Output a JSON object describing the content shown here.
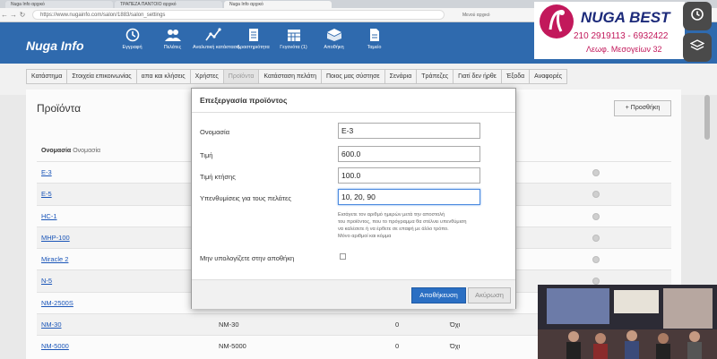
{
  "browser": {
    "tabs": [
      "Nuga Info αρχικό",
      "ΤΡΑΠΕΖΑ ΠΑΝΤΟΙΟ αρχικό",
      "Nuga Info αρχικό"
    ],
    "url": "https://www.nugainfo.com/salon/1883/salon_settings",
    "bookmark": "Μενού αρχικό"
  },
  "app": {
    "brand": "Nuga Info",
    "nav": [
      {
        "label": "Εγγραφή",
        "icon": "clock-icon"
      },
      {
        "label": "Πελάτες",
        "icon": "users-icon"
      },
      {
        "label": "Αναλυτική κατάσταση",
        "icon": "chart-icon"
      },
      {
        "label": "Δραστηριότητα",
        "icon": "document-icon"
      },
      {
        "label": "Γεγονότα (1)",
        "icon": "calendar-icon"
      },
      {
        "label": "Αποθήκη",
        "icon": "box-icon"
      },
      {
        "label": "Ταμείο",
        "icon": "file-icon"
      }
    ]
  },
  "logo": {
    "name": "NUGA BEST",
    "phone": "210 2919113 - 6932422",
    "address": "Λεωφ. Μεσογείων 32"
  },
  "menu": {
    "tabs": [
      "Κατάστημα",
      "Στοιχεία επικοινωνίας",
      "απα και κλήσεις",
      "Χρήστες",
      "Προϊόντα",
      "Κατάσταση πελάτη",
      "Ποιος μας σύστησε",
      "Σενάρια",
      "Τράπεζες",
      "Γιατί δεν ήρθε",
      "Έξοδα",
      "Αναφορές"
    ],
    "active_index": 4
  },
  "page": {
    "title": "Προϊόντα",
    "add_button": "+ Προσθήκη",
    "column_header": "Ονομασία",
    "column_header_sub": "Ονομασία",
    "rows": [
      {
        "name": "E-3",
        "code": "",
        "num": "",
        "yn": ""
      },
      {
        "name": "E-5",
        "code": "",
        "num": "",
        "yn": ""
      },
      {
        "name": "HC-1",
        "code": "",
        "num": "",
        "yn": ""
      },
      {
        "name": "MHP-100",
        "code": "",
        "num": "",
        "yn": ""
      },
      {
        "name": "Miracle 2",
        "code": "",
        "num": "",
        "yn": ""
      },
      {
        "name": "N-5",
        "code": "",
        "num": "",
        "yn": ""
      },
      {
        "name": "NM-2500S",
        "code": "",
        "num": "",
        "yn": ""
      },
      {
        "name": "NM-30",
        "code": "NM-30",
        "num": "0",
        "yn": "Όχι"
      },
      {
        "name": "NM-5000",
        "code": "NM-5000",
        "num": "0",
        "yn": "Όχι"
      }
    ]
  },
  "modal": {
    "title": "Επεξεργασία προϊόντος",
    "fields": {
      "name_label": "Ονομασία",
      "name_value": "E-3",
      "price_label": "Τιμή",
      "price_value": "600.0",
      "cost_label": "Τιμή κτήσης",
      "cost_value": "100.0",
      "reminders_label": "Υπενθυμίσεις για τους πελάτες",
      "reminders_value": "10, 20, 90"
    },
    "help_lines": [
      "Εισάγετε τον αριθμό ημερών μετά την αποστολή",
      "του προϊόντος, που το πρόγραμμα θα στέλνει υπενθύμιση",
      "να καλέσετε ή να έρθετε σε επαφή με άλλο τρόπο.",
      "Μόνο αριθμοί και κόμμα"
    ],
    "checkbox_label": "Μην υπολογίζετε στην αποθήκη",
    "save_button": "Αποθήκευση",
    "cancel_button": "Ακύρωση"
  },
  "colors": {
    "header_bg": "#2f6aae",
    "primary_button": "#2b6fc3",
    "link": "#1a55b8",
    "logo_accent": "#c2185b"
  }
}
